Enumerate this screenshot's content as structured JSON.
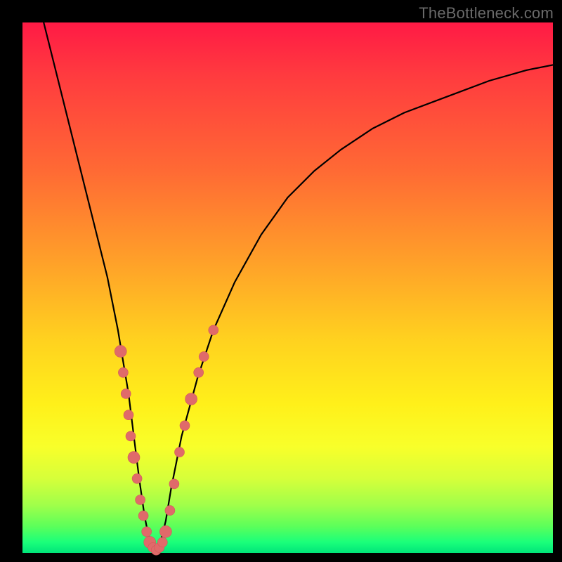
{
  "watermark": "TheBottleneck.com",
  "colors": {
    "dot": "#e06a6a",
    "curve": "#000000",
    "frame": "#000000"
  },
  "chart_data": {
    "type": "line",
    "title": "",
    "xlabel": "",
    "ylabel": "",
    "xlim": [
      0,
      100
    ],
    "ylim": [
      0,
      100
    ],
    "grid": false,
    "legend": false,
    "note": "Bottleneck-style V curve with gradient background. y is bottleneck percentage (0 = best / green, 100 = worst / red). Axis values are estimates inferred from the gradient and geometry; no tick labels are present on screen.",
    "series": [
      {
        "name": "curve",
        "x": [
          4,
          6,
          8,
          10,
          12,
          14,
          16,
          18,
          19,
          20,
          21,
          22,
          23,
          24,
          25,
          26,
          27,
          28,
          30,
          33,
          36,
          40,
          45,
          50,
          55,
          60,
          66,
          72,
          80,
          88,
          95,
          100
        ],
        "y": [
          100,
          92,
          84,
          76,
          68,
          60,
          52,
          42,
          36,
          30,
          22,
          14,
          7,
          2,
          0,
          2,
          6,
          12,
          22,
          33,
          42,
          51,
          60,
          67,
          72,
          76,
          80,
          83,
          86,
          89,
          91,
          92
        ]
      }
    ],
    "points": [
      {
        "x": 18.5,
        "y": 38
      },
      {
        "x": 19.0,
        "y": 34
      },
      {
        "x": 19.5,
        "y": 30
      },
      {
        "x": 20.0,
        "y": 26
      },
      {
        "x": 20.4,
        "y": 22
      },
      {
        "x": 21.0,
        "y": 18
      },
      {
        "x": 21.6,
        "y": 14
      },
      {
        "x": 22.2,
        "y": 10
      },
      {
        "x": 22.8,
        "y": 7
      },
      {
        "x": 23.4,
        "y": 4
      },
      {
        "x": 24.0,
        "y": 2
      },
      {
        "x": 24.6,
        "y": 1
      },
      {
        "x": 25.2,
        "y": 0.5
      },
      {
        "x": 25.8,
        "y": 1
      },
      {
        "x": 26.4,
        "y": 2
      },
      {
        "x": 27.0,
        "y": 4
      },
      {
        "x": 27.8,
        "y": 8
      },
      {
        "x": 28.6,
        "y": 13
      },
      {
        "x": 29.6,
        "y": 19
      },
      {
        "x": 30.6,
        "y": 24
      },
      {
        "x": 31.8,
        "y": 29
      },
      {
        "x": 33.2,
        "y": 34
      },
      {
        "x": 34.2,
        "y": 37
      },
      {
        "x": 36.0,
        "y": 42
      }
    ]
  }
}
